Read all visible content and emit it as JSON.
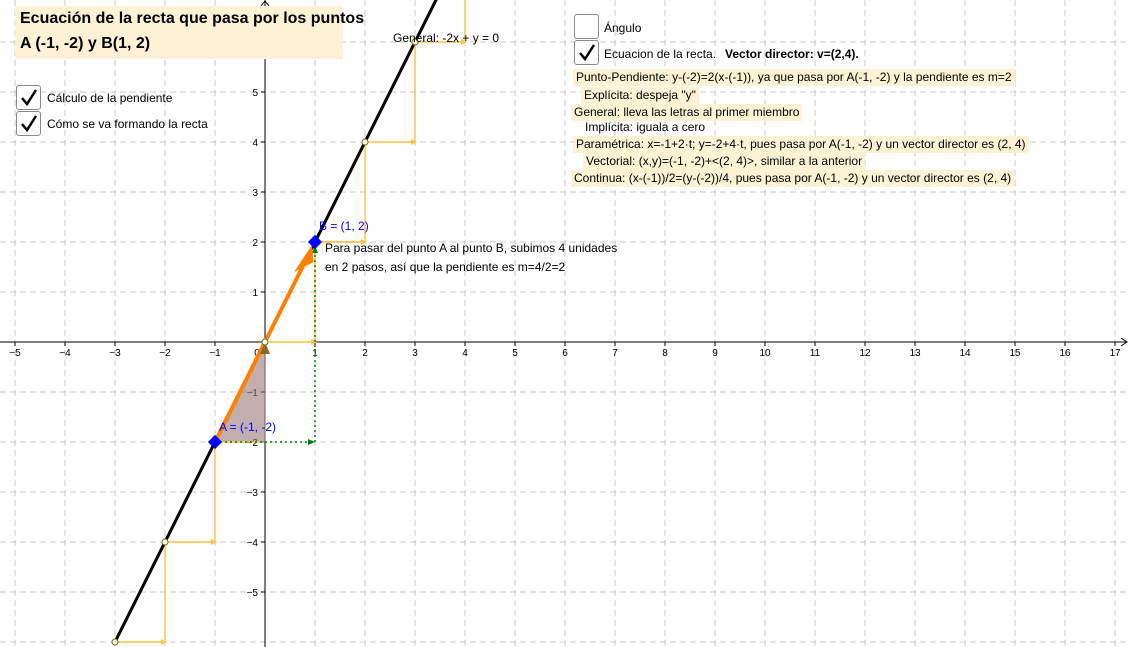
{
  "title": {
    "line1": "Ecuación de la recta que pasa por los puntos",
    "line2": "A (-1, -2) y B(1, 2)"
  },
  "checkboxes": {
    "pendiente": {
      "label": "Cálculo de la pendiente",
      "checked": true
    },
    "formando": {
      "label": "Cómo se va formando la recta",
      "checked": true
    },
    "angulo": {
      "label": "Ángulo",
      "checked": false
    },
    "ecuacion": {
      "label": "Ecuacion de la recta.",
      "checked": true
    }
  },
  "vector_director": "Vector director: v=(2,4).",
  "equations": {
    "punto_pendiente": "Punto-Pendiente: y-(-2)=2(x-(-1)), ya que pasa por A(-1, -2) y la pendiente es m=2",
    "explicita": "Explícita: despeja \"y\"",
    "general": "General: lleva las letras al primer miembro",
    "implicita": "Implícita: iguala a cero",
    "parametrica": "Paramétrica: x=-1+2·t; y=-2+4·t, pues pasa por A(-1, -2) y un vector director es (2, 4)",
    "vectorial": "Vectorial: (x,y)=(-1, -2)+<(2, 4)>, similar a la anterior",
    "continua": "Continua: (x-(-1))/2=(y-(-2))/4, pues pasa por A(-1, -2) y un vector director es (2, 4)"
  },
  "graph_labels": {
    "general_eq": "General: -2x + y = 0",
    "point_a": "A = (-1, -2)",
    "point_b": "B = (1, 2)",
    "explanation_line1": "Para pasar del punto A al punto B, subimos 4 unidades",
    "explanation_line2": "en 2 pasos, así que la pendiente es m=4/2=2"
  },
  "axes": {
    "x_ticks": [
      "−5",
      "−4",
      "−3",
      "−2",
      "−1",
      "0",
      "1",
      "2",
      "3",
      "4",
      "5",
      "6",
      "7",
      "8",
      "9",
      "10",
      "11",
      "12",
      "13",
      "14",
      "15",
      "16",
      "17"
    ],
    "y_ticks": [
      "5",
      "4",
      "3",
      "2",
      "1",
      "−1",
      "−2",
      "−3",
      "−4",
      "−5"
    ]
  },
  "colors": {
    "line": "#000000",
    "vector": "#ff7f00",
    "points": "#0000ff",
    "steps": "#ffc24a",
    "dotted": "#008000",
    "triangle": "#9a7878",
    "highlight": "#fbf3d3"
  }
}
